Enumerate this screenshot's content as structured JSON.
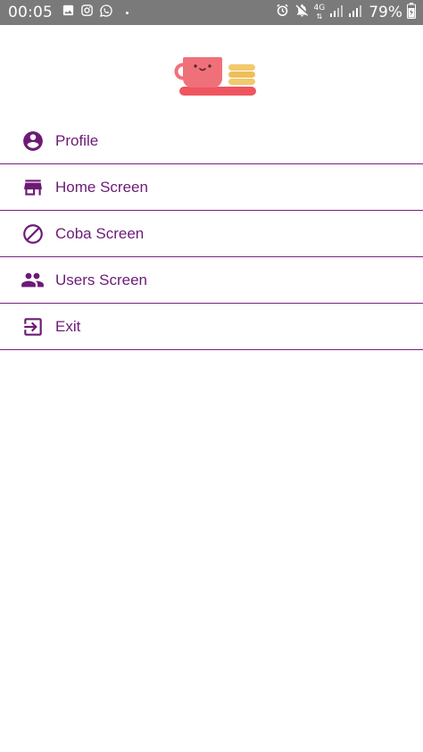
{
  "status_bar": {
    "time": "00:05",
    "network_type": "4G",
    "battery": "79%",
    "icons": [
      "image-icon",
      "instagram-icon",
      "whatsapp-icon",
      "notification-dot",
      "alarm-icon",
      "mute-icon",
      "signal-icon",
      "battery-icon"
    ]
  },
  "header": {
    "logo_icon": "coffee-cup-with-cookies-logo"
  },
  "menu": {
    "items": [
      {
        "label": "Profile",
        "icon": "account-circle-icon"
      },
      {
        "label": "Home Screen",
        "icon": "store-icon"
      },
      {
        "label": "Coba Screen",
        "icon": "block-icon"
      },
      {
        "label": "Users Screen",
        "icon": "people-icon"
      },
      {
        "label": "Exit",
        "icon": "exit-icon"
      }
    ]
  },
  "colors": {
    "accent": "#6d1a76",
    "divider": "#7b1f7f",
    "status_bar_bg": "#7a7a7a",
    "cup": "#f0707a",
    "saucer": "#ef5560",
    "cookies": "#f2c96a"
  }
}
